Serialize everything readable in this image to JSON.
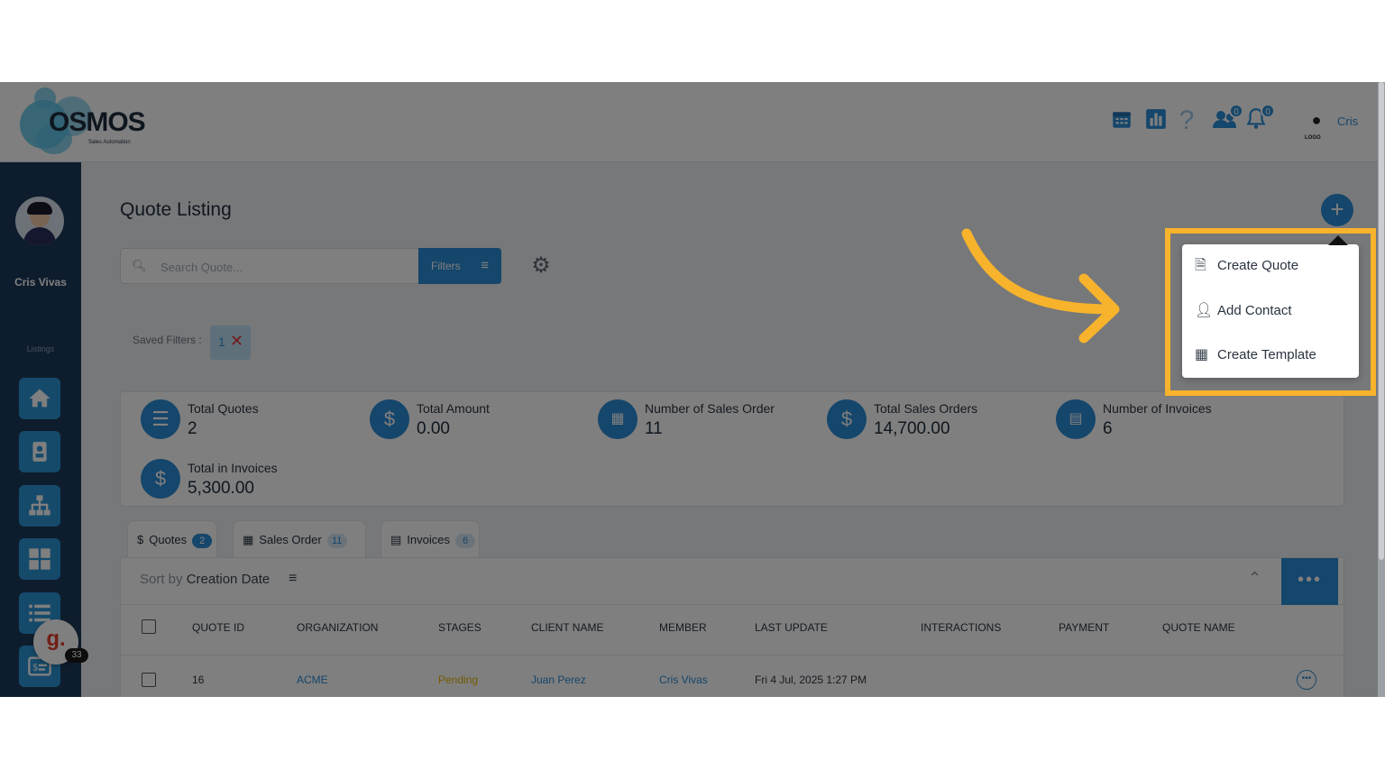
{
  "header": {
    "logo_text": "OSMOS",
    "logo_tagline": "Sales Automation",
    "icons": [
      "calendar-icon",
      "chart-icon",
      "help-icon",
      "users-icon",
      "bell-icon"
    ],
    "users_badge": "0",
    "bell_badge": "0",
    "user_logo_text": "LOGO",
    "user_name": "Cris"
  },
  "sidebar": {
    "user_name": "Cris Vivas",
    "section_label": "Listings",
    "items": [
      "home-icon",
      "contacts-icon",
      "org-chart-icon",
      "grid-icon",
      "list-icon",
      "invoice-icon"
    ],
    "chat_count": "33",
    "chat_letter": "g."
  },
  "main": {
    "title": "Quote Listing",
    "search_placeholder": "Search Quote...",
    "filters_label": "Filters",
    "saved_filters_label": "Saved Filters :",
    "saved_filter_count": "1"
  },
  "stats": [
    {
      "label": "Total Quotes",
      "value": "2",
      "icon": "list-icon"
    },
    {
      "label": "Total Amount",
      "value": "0.00",
      "icon": "dollar-icon"
    },
    {
      "label": "Number of Sales Order",
      "value": "11",
      "icon": "cash-icon"
    },
    {
      "label": "Total Sales Orders",
      "value": "14,700.00",
      "icon": "dollar-icon"
    },
    {
      "label": "Number of Invoices",
      "value": "6",
      "icon": "document-icon"
    },
    {
      "label": "Total in Invoices",
      "value": "5,300.00",
      "icon": "dollar-icon"
    }
  ],
  "tabs": [
    {
      "label": "Quotes",
      "count": "2",
      "icon": "$"
    },
    {
      "label": "Sales Order",
      "count": "11",
      "icon": "cash"
    },
    {
      "label": "Invoices",
      "count": "6",
      "icon": "doc"
    }
  ],
  "table": {
    "sort_prefix": "Sort by",
    "sort_field": "Creation Date",
    "columns": [
      "QUOTE ID",
      "ORGANIZATION",
      "STAGES",
      "CLIENT NAME",
      "MEMBER",
      "LAST UPDATE",
      "INTERACTIONS",
      "PAYMENT",
      "QUOTE NAME"
    ],
    "rows": [
      {
        "quote_id": "16",
        "organization": "ACME",
        "stage": "Pending",
        "client_name": "Juan Perez",
        "member": "Cris Vivas",
        "last_update": "Fri 4 Jul, 2025 1:27 PM",
        "interactions": "",
        "payment": "",
        "quote_name": ""
      }
    ]
  },
  "dropdown": {
    "items": [
      {
        "label": "Create Quote",
        "icon": "quote-icon"
      },
      {
        "label": "Add Contact",
        "icon": "user-add-icon"
      },
      {
        "label": "Create Template",
        "icon": "template-icon"
      }
    ]
  },
  "colors": {
    "accent": "#2b8cd6",
    "sidebar": "#1d3a5a",
    "highlight": "#f7b32b",
    "pending": "#e0b400"
  }
}
